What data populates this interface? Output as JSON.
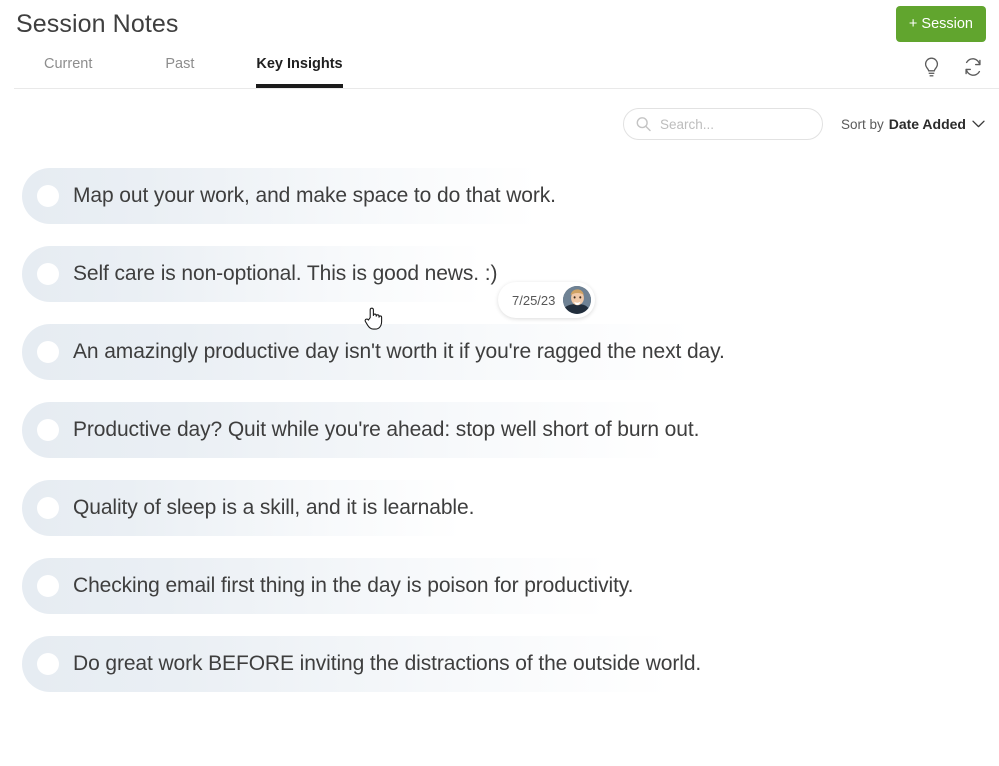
{
  "header": {
    "title": "Session Notes",
    "add_session_label": "+ Session",
    "icons": [
      {
        "name": "lightbulb-icon",
        "label": "Ideas"
      },
      {
        "name": "sync-icon",
        "label": "Refresh"
      }
    ]
  },
  "tabs": [
    {
      "label": "Current",
      "active": false
    },
    {
      "label": "Past",
      "active": false
    },
    {
      "label": "Key Insights",
      "active": true
    }
  ],
  "toolbar": {
    "search_placeholder": "Search...",
    "search_value": "",
    "sort_label": "Sort by",
    "sort_value": "Date Added",
    "sort_options": [
      "Date Added"
    ]
  },
  "insights": [
    {
      "text": "Map out your work, and make space to do that work."
    },
    {
      "text": "Self care is non-optional. This is good news. :)"
    },
    {
      "text": "An amazingly productive day isn't worth it if you're ragged the next day."
    },
    {
      "text": "Productive day? Quit while you're ahead: stop well short of burn out."
    },
    {
      "text": "Quality of sleep is a skill, and it is learnable."
    },
    {
      "text": "Checking email first thing in the day is poison for productivity."
    },
    {
      "text": "Do great work BEFORE inviting the distractions of the outside world."
    }
  ],
  "hover_meta": {
    "date": "7/25/23",
    "avatar_alt": "User avatar"
  },
  "colors": {
    "accent_green": "#61a52e",
    "active_tab": "#1b1b1b",
    "pill_start": "#e6ecf2",
    "pill_end": "#ffffff",
    "text": "#3e3e3e",
    "muted_text": "#8d8d8d"
  }
}
